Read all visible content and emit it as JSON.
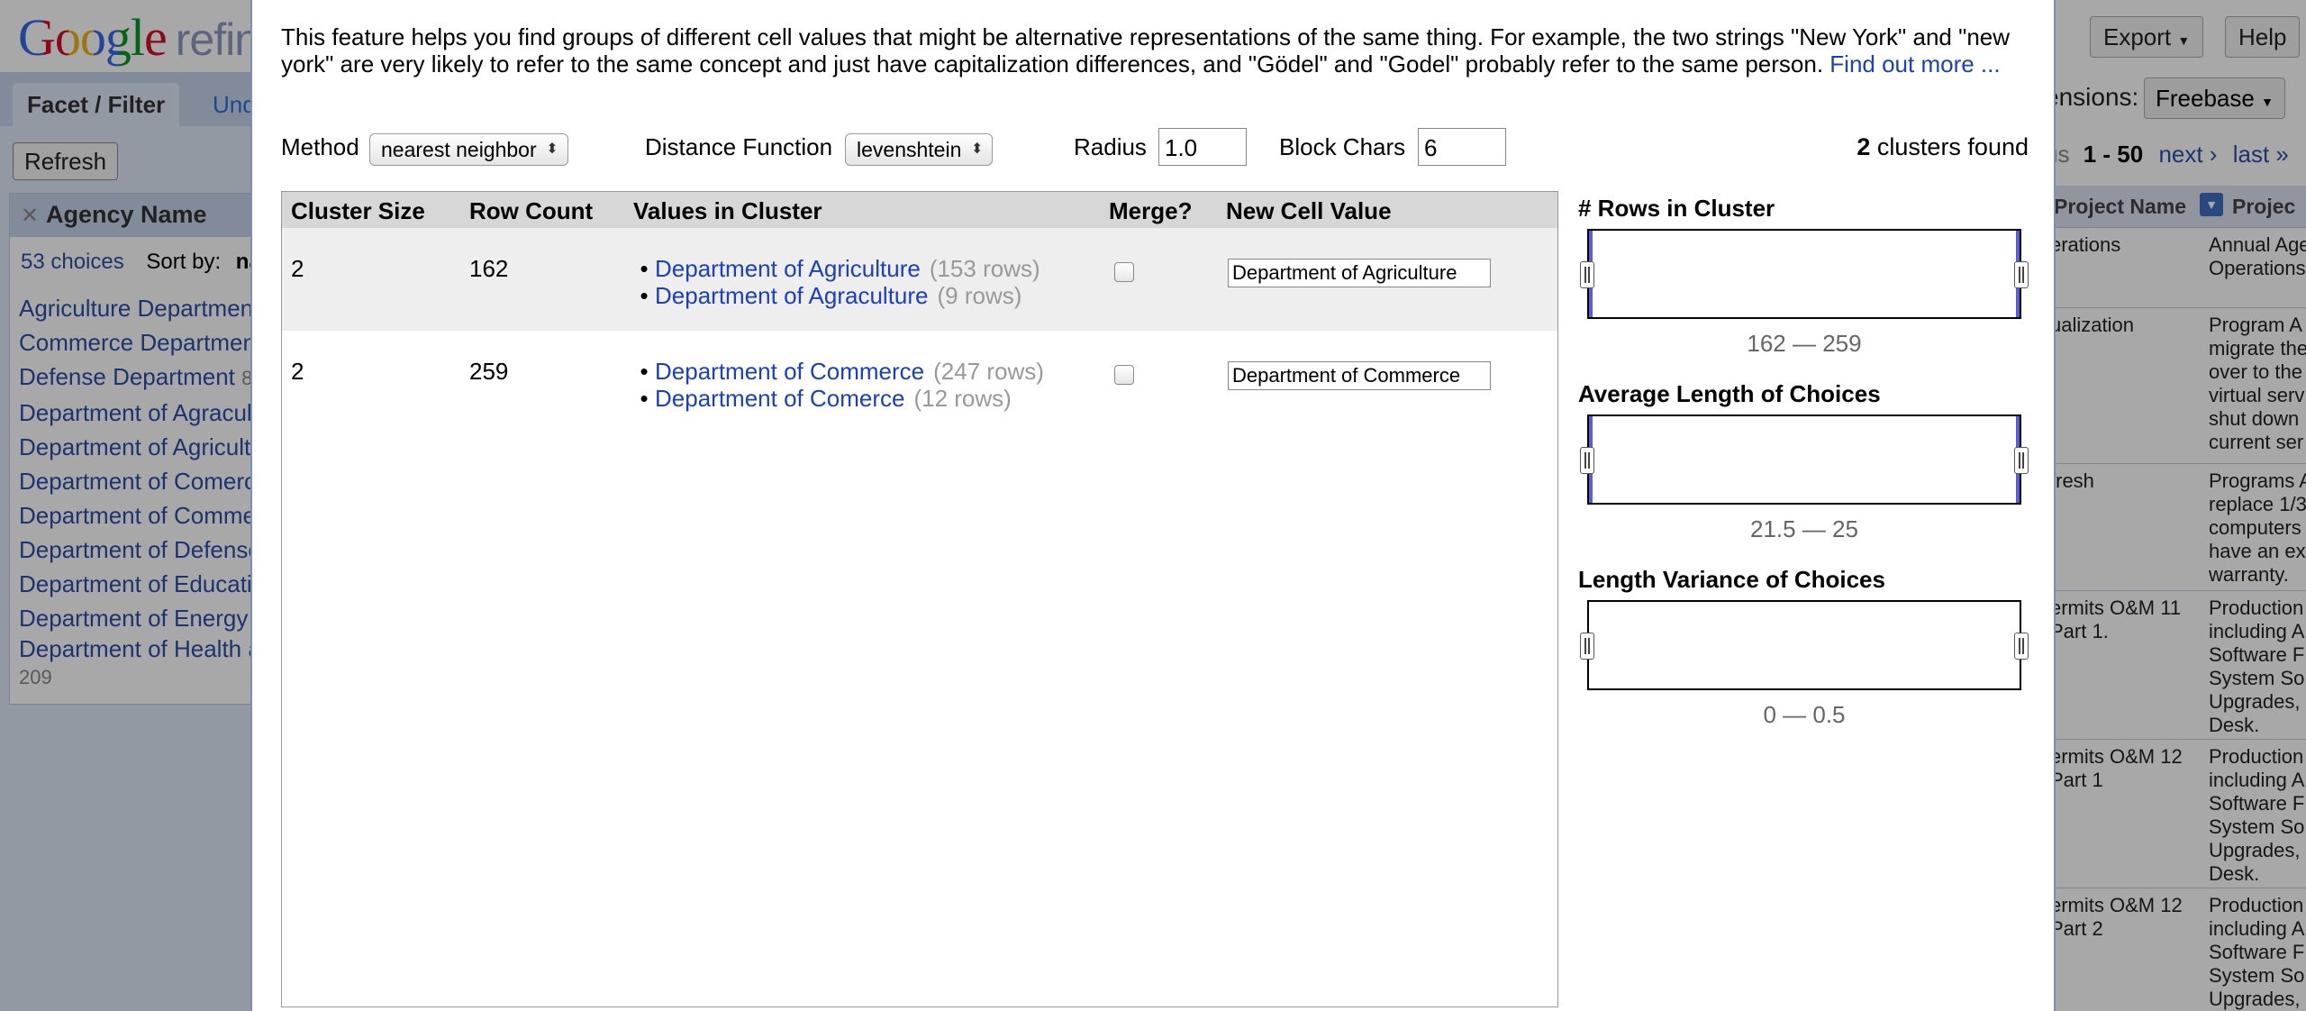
{
  "background": {
    "logo_brand": "Google",
    "logo_product": "refine",
    "tabs": {
      "facet_filter": "Facet / Filter",
      "undo": "Undo / Redo"
    },
    "refresh_label": "Refresh",
    "facet": {
      "remove_icon": "close-icon",
      "title": "Agency Name",
      "choices_count": "53 choices",
      "sort_by": "Sort by:",
      "sort_value": "name",
      "items": [
        {
          "label": "Agriculture Department",
          "count": ""
        },
        {
          "label": "Commerce Department",
          "count": ""
        },
        {
          "label": "Defense Department",
          "count": "8"
        },
        {
          "label": "Department of Agraculture",
          "count": ""
        },
        {
          "label": "Department of Agriculture",
          "count": ""
        },
        {
          "label": "Department of Comerce",
          "count": ""
        },
        {
          "label": "Department of Commerce",
          "count": ""
        },
        {
          "label": "Department of Defense",
          "count": ""
        },
        {
          "label": "Department of Education",
          "count": ""
        },
        {
          "label": "Department of Energy",
          "count": ""
        },
        {
          "label": "Department of Health and Human Services",
          "count": "209"
        }
      ]
    },
    "toolbar": {
      "ellipsis_label": "...",
      "export_label": "Export",
      "help_label": "Help"
    },
    "extensions_label": "ensions:",
    "extensions_value": "Freebase",
    "paging": {
      "prefix": "us",
      "range": "1 - 50",
      "next": "next ›",
      "last": "last »"
    },
    "grid": {
      "col_project_name": "Project Name",
      "col_project_desc": "Projec",
      "rows": [
        {
          "name": "erations",
          "desc": "Annual Age Operations"
        },
        {
          "name": "ualization",
          "desc": "Program A migrate the over to the virtual serv shut down current ser"
        },
        {
          "name": "fresh",
          "desc": "Programs A replace 1/3 computers have an ex warranty."
        },
        {
          "name": "ermits O&M 11 Part 1.",
          "desc": "Production including A Software F System So Upgrades, Desk."
        },
        {
          "name": "ermits O&M 12 Part 1",
          "desc": "Production including A Software F System So Upgrades, Desk."
        },
        {
          "name": "ermits O&M 12 Part 2",
          "desc": "Production including A Software F System So Upgrades,"
        }
      ]
    }
  },
  "dialog": {
    "description": "This feature helps you find groups of different cell values that might be alternative representations of the same thing. For example, the two strings \"New York\" and \"new york\" are very likely to refer to the same concept and just have capitalization differences, and \"Gödel\" and \"Godel\" probably refer to the same person.",
    "find_out_more": "Find out more ...",
    "method_label": "Method",
    "method_value": "nearest neighbor",
    "distance_label": "Distance Function",
    "distance_value": "levenshtein",
    "radius_label": "Radius",
    "radius_value": "1.0",
    "block_chars_label": "Block Chars",
    "block_chars_value": "6",
    "clusters_found_count": "2",
    "clusters_found_label": "clusters found",
    "table": {
      "headers": {
        "cluster_size": "Cluster Size",
        "row_count": "Row Count",
        "values": "Values in Cluster",
        "merge": "Merge?",
        "new_value": "New Cell Value"
      },
      "rows": [
        {
          "cluster_size": "2",
          "row_count": "162",
          "values": [
            {
              "value": "Department of Agriculture",
              "count": "(153 rows)"
            },
            {
              "value": "Department of Agraculture",
              "count": "(9 rows)"
            }
          ],
          "merge": false,
          "new_value": "Department of Agriculture"
        },
        {
          "cluster_size": "2",
          "row_count": "259",
          "values": [
            {
              "value": "Department of Commerce",
              "count": "(247 rows)"
            },
            {
              "value": "Department of Comerce",
              "count": "(12 rows)"
            }
          ],
          "merge": false,
          "new_value": "Department of Commerce"
        }
      ]
    },
    "histograms": [
      {
        "title": "# Rows in Cluster",
        "range": "162 — 259"
      },
      {
        "title": "Average Length of Choices",
        "range": "21.5 — 25"
      },
      {
        "title": "Length Variance of Choices",
        "range": "0 — 0.5"
      }
    ],
    "colors": {
      "link": "#1a3fc4",
      "muted": "#999999",
      "histogram_edge": "#5b5bdb"
    }
  }
}
